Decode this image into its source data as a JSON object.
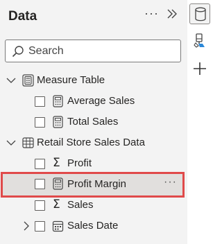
{
  "pane": {
    "title": "Data",
    "more_label": "···",
    "collapse_icon": "chevron-double-right-icon"
  },
  "search": {
    "placeholder": "Search",
    "icon": "search-icon"
  },
  "tree": {
    "measure_table": {
      "label": "Measure Table",
      "icon": "table-calculator-icon",
      "fields": [
        {
          "label": "Average Sales",
          "icon": "calculator-icon"
        },
        {
          "label": "Total Sales",
          "icon": "calculator-icon"
        }
      ]
    },
    "sales_table": {
      "label": "Retail Store Sales Data",
      "icon": "table-icon",
      "fields": [
        {
          "label": "Profit",
          "icon": "sigma-icon",
          "glyph": "Σ"
        },
        {
          "label": "Profit Margin",
          "icon": "calculator-icon",
          "selected": true,
          "more": "···"
        },
        {
          "label": "Sales",
          "icon": "sigma-icon",
          "glyph": "Σ"
        },
        {
          "label": "Sales Date",
          "icon": "calendar-icon"
        }
      ]
    }
  },
  "rail": {
    "items": [
      {
        "icon": "data-cylinder-icon",
        "active": true
      },
      {
        "icon": "format-paintbrush-icon"
      },
      {
        "icon": "plus-icon"
      }
    ]
  },
  "colors": {
    "pane_bg": "#f3f3f3",
    "selected_bg": "#e1dfdd",
    "highlight_border": "#e04a4a"
  }
}
